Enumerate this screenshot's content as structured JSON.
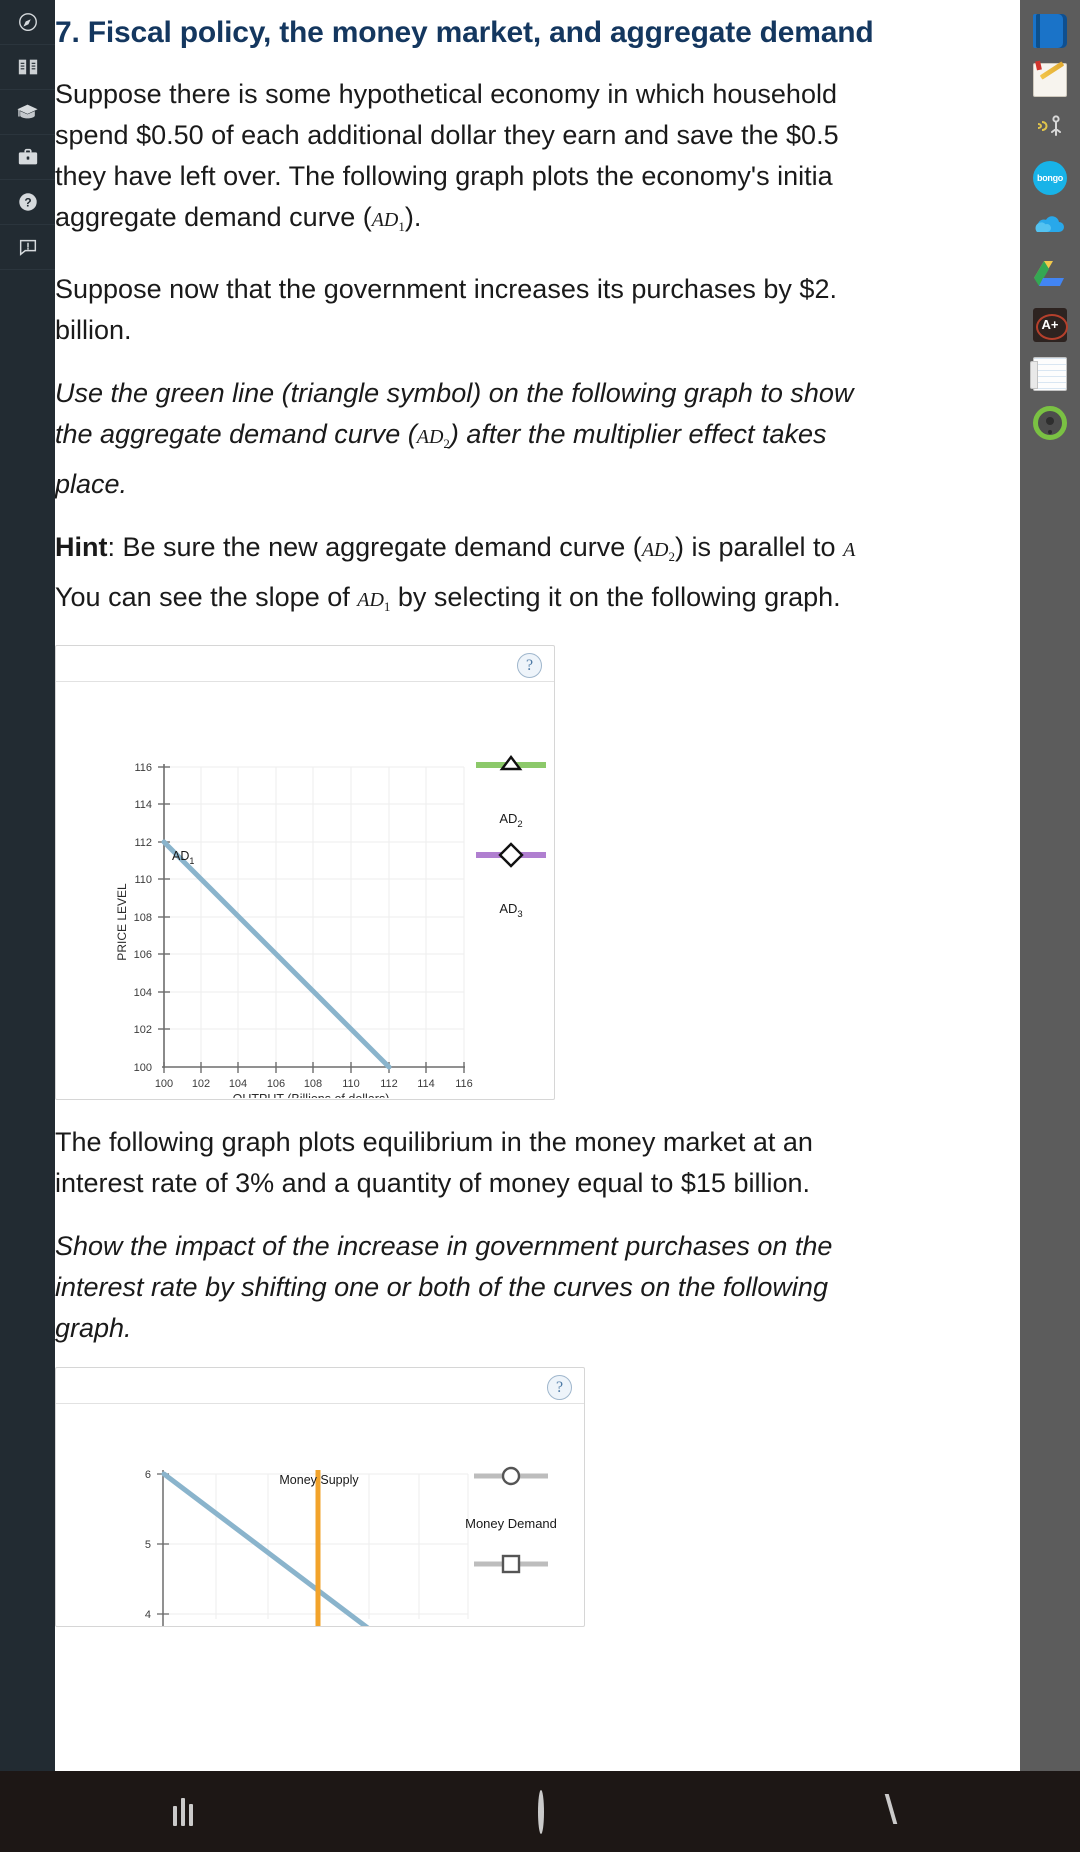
{
  "left_rail": {
    "items": [
      {
        "name": "compass-icon",
        "label": "Dashboard"
      },
      {
        "name": "book-open-icon",
        "label": "Courses"
      },
      {
        "name": "graduation-cap-icon",
        "label": "Grades"
      },
      {
        "name": "briefcase-icon",
        "label": "Careers"
      },
      {
        "name": "help-circle-icon",
        "label": "Help"
      },
      {
        "name": "feedback-icon",
        "label": "Feedback"
      }
    ]
  },
  "right_rail": {
    "items": [
      {
        "name": "blue-book-icon",
        "label": "eBook"
      },
      {
        "name": "notepad-pencil-icon",
        "label": "Notes"
      },
      {
        "name": "audio-read-icon",
        "label": "Read Aloud"
      },
      {
        "name": "bongo-icon",
        "label": "bongo"
      },
      {
        "name": "onedrive-cloud-icon",
        "label": "OneDrive"
      },
      {
        "name": "google-drive-icon",
        "label": "Google Drive"
      },
      {
        "name": "grade-aplus-icon",
        "label": "A+"
      },
      {
        "name": "flashcards-icon",
        "label": "Flashcards"
      },
      {
        "name": "profile-ring-icon",
        "label": "Profile"
      }
    ]
  },
  "header": {
    "title": "7. Fiscal policy, the money market, and aggregate demand"
  },
  "body": {
    "p1_a": "Suppose there is some hypothetical economy in which household",
    "p1_b": "spend $0.50 of each additional dollar they earn and save the $0.5",
    "p1_c": "they have left over. The following graph plots the economy's initia",
    "p1_d_pre": "aggregate demand curve (",
    "p1_d_var": "AD",
    "p1_d_sub": "1",
    "p1_d_post": ").",
    "p2_a": "Suppose now that the government increases its purchases by $2.",
    "p2_b": "billion.",
    "p3_a": "Use the green line (triangle symbol) on the following graph to show",
    "p3_b_pre": "the aggregate demand curve (",
    "p3_b_var": "AD",
    "p3_b_sub": "2",
    "p3_b_post": ") after the multiplier effect takes",
    "p3_c": "place.",
    "p4_hint_label": "Hint",
    "p4_a_pre": ": Be sure the new aggregate demand curve (",
    "p4_a_var": "AD",
    "p4_a_sub": "2",
    "p4_a_post": ") is parallel to ",
    "p4_a_tail_var": "A",
    "p4_b_pre": "You can see the slope of ",
    "p4_b_var": "AD",
    "p4_b_sub": "1",
    "p4_b_post": " by selecting it on the following graph.",
    "p5_a": "The following graph plots equilibrium in the money market at an",
    "p5_b": "interest rate of 3% and a quantity of money equal to $15 billion.",
    "p6_a": "Show the impact of the increase in government purchases on the",
    "p6_b": "interest rate by shifting one or both of the curves on the following",
    "p6_c": "graph."
  },
  "graph1": {
    "help_label": "?",
    "colors": {
      "ad1_line": "#8ab4cc",
      "ad2_line": "#8cc96a",
      "ad3_line": "#b07fd0",
      "grid": "#e9e9e9",
      "axis": "#6d6d6d"
    },
    "legend": [
      {
        "name": "AD",
        "sub": "2",
        "symbol": "triangle",
        "color": "#8cc96a"
      },
      {
        "name": "AD",
        "sub": "3",
        "symbol": "diamond",
        "color": "#b07fd0"
      }
    ]
  },
  "graph2": {
    "help_label": "?",
    "colors": {
      "demand_line": "#8ab4cc",
      "supply_line": "#f2a32b",
      "grid": "#e9e9e9"
    },
    "supply_label": "Money Supply",
    "legend": [
      {
        "label": "",
        "symbol": "circle"
      },
      {
        "label": "Money Demand",
        "symbol": "square"
      }
    ]
  },
  "chart_data": [
    {
      "type": "line",
      "title": "",
      "xlabel": "OUTPUT (Billions of dollars)",
      "ylabel": "PRICE LEVEL",
      "xlim": [
        99,
        117
      ],
      "ylim": [
        100,
        116
      ],
      "xticks": [
        100,
        102,
        104,
        106,
        108,
        110,
        112,
        114,
        116
      ],
      "yticks": [
        100,
        102,
        104,
        106,
        108,
        110,
        112,
        114,
        116
      ],
      "grid": true,
      "legend_position": "right",
      "series": [
        {
          "name": "AD1",
          "label": "AD",
          "label_sub": "1",
          "color": "#8ab4cc",
          "symbol": "none",
          "x": [
            100,
            112
          ],
          "y": [
            112,
            100
          ]
        },
        {
          "name": "AD2",
          "label": "AD",
          "label_sub": "2",
          "color": "#8cc96a",
          "symbol": "triangle",
          "x": [],
          "y": []
        },
        {
          "name": "AD3",
          "label": "AD",
          "label_sub": "3",
          "color": "#b07fd0",
          "symbol": "diamond",
          "x": [],
          "y": []
        }
      ]
    },
    {
      "type": "line",
      "title": "",
      "xlabel": "",
      "ylabel": "",
      "ylim": [
        4,
        6
      ],
      "yticks": [
        4,
        5,
        6
      ],
      "grid": true,
      "legend_position": "right",
      "annotations": [
        {
          "text": "Money Supply",
          "x": 15,
          "y": 5.85
        }
      ],
      "series": [
        {
          "name": "Money Demand",
          "color": "#8ab4cc",
          "symbol": "none",
          "x": [
            0,
            20
          ],
          "y": [
            6,
            3.6
          ]
        },
        {
          "name": "Money Supply",
          "color": "#f2a32b",
          "symbol": "none",
          "x": [
            15,
            15
          ],
          "y": [
            6,
            3.6
          ]
        }
      ]
    }
  ],
  "navbar": {
    "items": [
      {
        "name": "recents-button",
        "glyph": "III"
      },
      {
        "name": "home-button",
        "glyph": "O"
      },
      {
        "name": "back-button",
        "glyph": "<"
      }
    ]
  }
}
